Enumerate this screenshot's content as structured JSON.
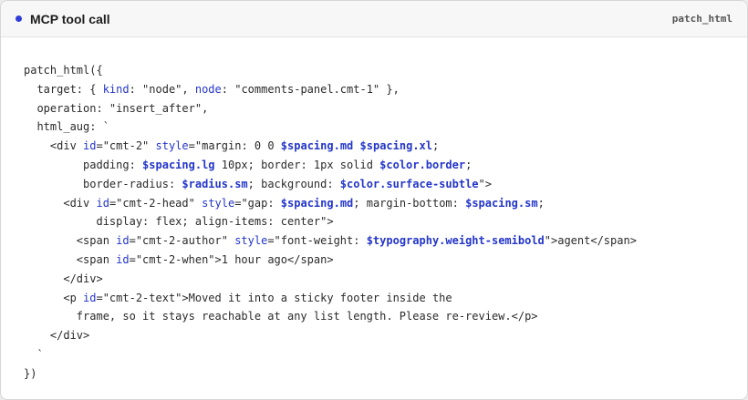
{
  "header": {
    "title": "MCP tool call",
    "badge": "patch_html",
    "accent_color": "#2f3ed8"
  },
  "code": {
    "lines": [
      [
        {
          "t": "patch_html({",
          "c": ""
        }
      ],
      [
        {
          "t": "  target: { ",
          "c": ""
        },
        {
          "t": "kind",
          "c": "k"
        },
        {
          "t": ": \"node\", ",
          "c": ""
        },
        {
          "t": "node",
          "c": "k"
        },
        {
          "t": ": \"comments-panel.cmt-1\" },",
          "c": ""
        }
      ],
      [
        {
          "t": "  operation: \"insert_after\",",
          "c": ""
        }
      ],
      [
        {
          "t": "  html_aug: `",
          "c": ""
        }
      ],
      [
        {
          "t": "    <div ",
          "c": ""
        },
        {
          "t": "id",
          "c": "k"
        },
        {
          "t": "=\"cmt-2\" ",
          "c": ""
        },
        {
          "t": "style",
          "c": "k"
        },
        {
          "t": "=\"margin: 0 0 ",
          "c": ""
        },
        {
          "t": "$spacing.md",
          "c": "t"
        },
        {
          "t": " ",
          "c": ""
        },
        {
          "t": "$spacing.xl",
          "c": "t"
        },
        {
          "t": ";",
          "c": ""
        }
      ],
      [
        {
          "t": "         padding: ",
          "c": ""
        },
        {
          "t": "$spacing.lg",
          "c": "t"
        },
        {
          "t": " 10px; border: 1px solid ",
          "c": ""
        },
        {
          "t": "$color.border",
          "c": "t"
        },
        {
          "t": ";",
          "c": ""
        }
      ],
      [
        {
          "t": "         border-radius: ",
          "c": ""
        },
        {
          "t": "$radius.sm",
          "c": "t"
        },
        {
          "t": "; background: ",
          "c": ""
        },
        {
          "t": "$color.surface-subtle",
          "c": "t"
        },
        {
          "t": "\">",
          "c": ""
        }
      ],
      [
        {
          "t": "      <div ",
          "c": ""
        },
        {
          "t": "id",
          "c": "k"
        },
        {
          "t": "=\"cmt-2-head\" ",
          "c": ""
        },
        {
          "t": "style",
          "c": "k"
        },
        {
          "t": "=\"gap: ",
          "c": ""
        },
        {
          "t": "$spacing.md",
          "c": "t"
        },
        {
          "t": "; margin-bottom: ",
          "c": ""
        },
        {
          "t": "$spacing.sm",
          "c": "t"
        },
        {
          "t": ";",
          "c": ""
        }
      ],
      [
        {
          "t": "           display: flex; align-items: center\">",
          "c": ""
        }
      ],
      [
        {
          "t": "        <span ",
          "c": ""
        },
        {
          "t": "id",
          "c": "k"
        },
        {
          "t": "=\"cmt-2-author\" ",
          "c": ""
        },
        {
          "t": "style",
          "c": "k"
        },
        {
          "t": "=\"font-weight: ",
          "c": ""
        },
        {
          "t": "$typography.weight-semibold",
          "c": "t"
        },
        {
          "t": "\">agent</span>",
          "c": ""
        }
      ],
      [
        {
          "t": "        <span ",
          "c": ""
        },
        {
          "t": "id",
          "c": "k"
        },
        {
          "t": "=\"cmt-2-when\">1 hour ago</span>",
          "c": ""
        }
      ],
      [
        {
          "t": "      </div>",
          "c": ""
        }
      ],
      [
        {
          "t": "      <p ",
          "c": ""
        },
        {
          "t": "id",
          "c": "k"
        },
        {
          "t": "=\"cmt-2-text\">Moved it into a sticky footer inside the",
          "c": ""
        }
      ],
      [
        {
          "t": "        frame, so it stays reachable at any list length. Please re-review.</p>",
          "c": ""
        }
      ],
      [
        {
          "t": "    </div>",
          "c": ""
        }
      ],
      [
        {
          "t": "  `",
          "c": ""
        }
      ],
      [
        {
          "t": "})",
          "c": ""
        }
      ]
    ]
  }
}
